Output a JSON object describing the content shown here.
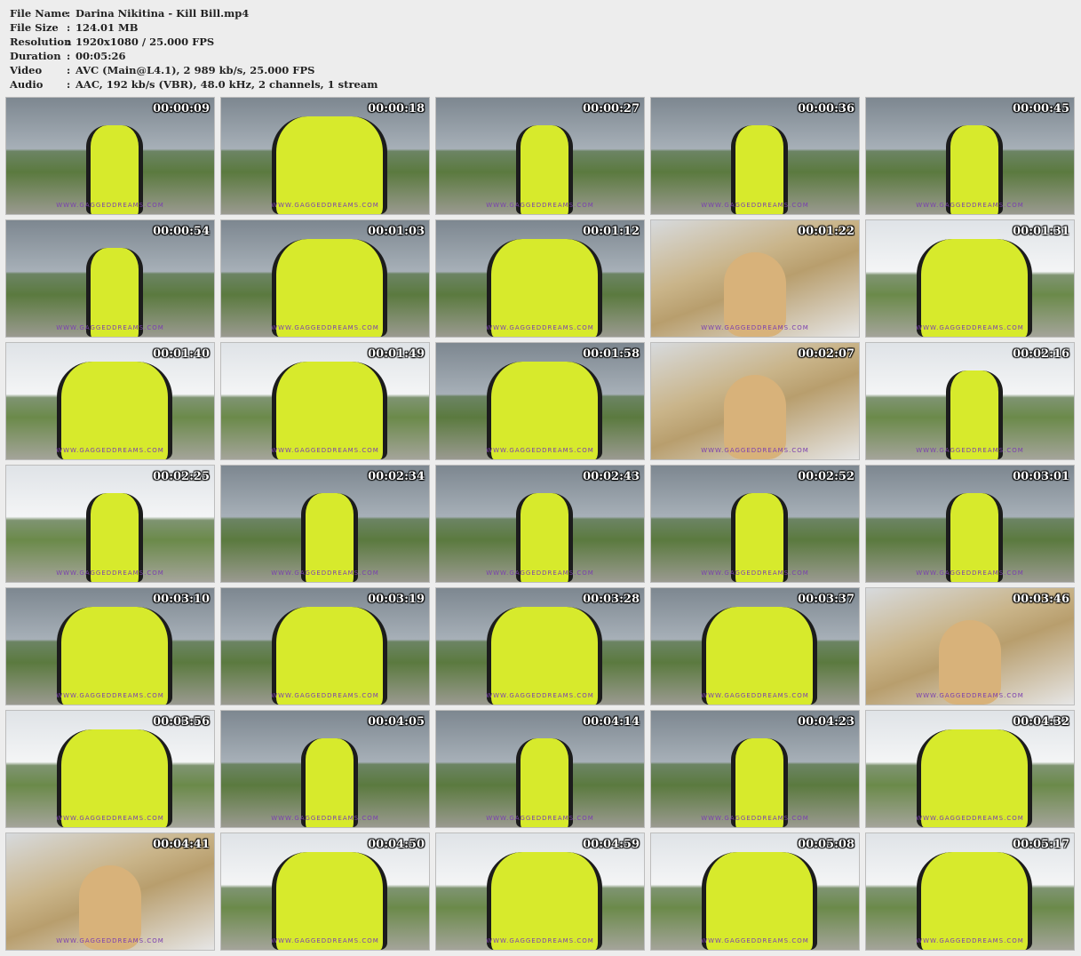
{
  "info": [
    {
      "label": "File Name",
      "value": "Darina Nikitina - Kill Bill.mp4"
    },
    {
      "label": "File Size",
      "value": "124.01 MB"
    },
    {
      "label": "Resolution",
      "value": "1920x1080 / 25.000 FPS"
    },
    {
      "label": "Duration",
      "value": "00:05:26"
    },
    {
      "label": "Video",
      "value": "AVC (Main@L4.1), 2 989 kb/s, 25.000 FPS"
    },
    {
      "label": "Audio",
      "value": "AAC, 192 kb/s (VBR), 48.0 kHz, 2 channels, 1 stream"
    }
  ],
  "separator": ":",
  "watermark": "WWW.GAGGEDDREAMS.COM",
  "colors": {
    "background": "#ededed",
    "suit_yellow": "#d7ea2c",
    "watermark": "#7a3fb0"
  },
  "thumbnails": [
    {
      "time": "00:00:09",
      "style": "storm",
      "figure": "body"
    },
    {
      "time": "00:00:18",
      "style": "storm",
      "figure": "wide"
    },
    {
      "time": "00:00:27",
      "style": "storm",
      "figure": "body"
    },
    {
      "time": "00:00:36",
      "style": "storm",
      "figure": "body"
    },
    {
      "time": "00:00:45",
      "style": "storm",
      "figure": "body"
    },
    {
      "time": "00:00:54",
      "style": "storm",
      "figure": "body"
    },
    {
      "time": "00:01:03",
      "style": "storm",
      "figure": "wide"
    },
    {
      "time": "00:01:12",
      "style": "storm",
      "figure": "wide"
    },
    {
      "time": "00:01:22",
      "style": "closeup",
      "figure": "head"
    },
    {
      "time": "00:01:31",
      "style": "bright",
      "figure": "wide"
    },
    {
      "time": "00:01:40",
      "style": "bright",
      "figure": "wide"
    },
    {
      "time": "00:01:49",
      "style": "bright",
      "figure": "wide"
    },
    {
      "time": "00:01:58",
      "style": "storm",
      "figure": "wide"
    },
    {
      "time": "00:02:07",
      "style": "closeup",
      "figure": "head"
    },
    {
      "time": "00:02:16",
      "style": "bright",
      "figure": "body"
    },
    {
      "time": "00:02:25",
      "style": "bright",
      "figure": "body"
    },
    {
      "time": "00:02:34",
      "style": "storm",
      "figure": "body"
    },
    {
      "time": "00:02:43",
      "style": "storm",
      "figure": "body"
    },
    {
      "time": "00:02:52",
      "style": "storm",
      "figure": "body"
    },
    {
      "time": "00:03:01",
      "style": "storm",
      "figure": "body"
    },
    {
      "time": "00:03:10",
      "style": "storm",
      "figure": "wide"
    },
    {
      "time": "00:03:19",
      "style": "storm",
      "figure": "wide"
    },
    {
      "time": "00:03:28",
      "style": "storm",
      "figure": "wide"
    },
    {
      "time": "00:03:37",
      "style": "storm",
      "figure": "wide"
    },
    {
      "time": "00:03:46",
      "style": "closeup",
      "figure": "head"
    },
    {
      "time": "00:03:56",
      "style": "bright",
      "figure": "wide"
    },
    {
      "time": "00:04:05",
      "style": "storm",
      "figure": "body"
    },
    {
      "time": "00:04:14",
      "style": "storm",
      "figure": "body"
    },
    {
      "time": "00:04:23",
      "style": "storm",
      "figure": "body"
    },
    {
      "time": "00:04:32",
      "style": "bright",
      "figure": "wide"
    },
    {
      "time": "00:04:41",
      "style": "closeup",
      "figure": "head"
    },
    {
      "time": "00:04:50",
      "style": "bright",
      "figure": "wide"
    },
    {
      "time": "00:04:59",
      "style": "bright",
      "figure": "wide"
    },
    {
      "time": "00:05:08",
      "style": "bright",
      "figure": "wide"
    },
    {
      "time": "00:05:17",
      "style": "bright",
      "figure": "wide"
    }
  ]
}
